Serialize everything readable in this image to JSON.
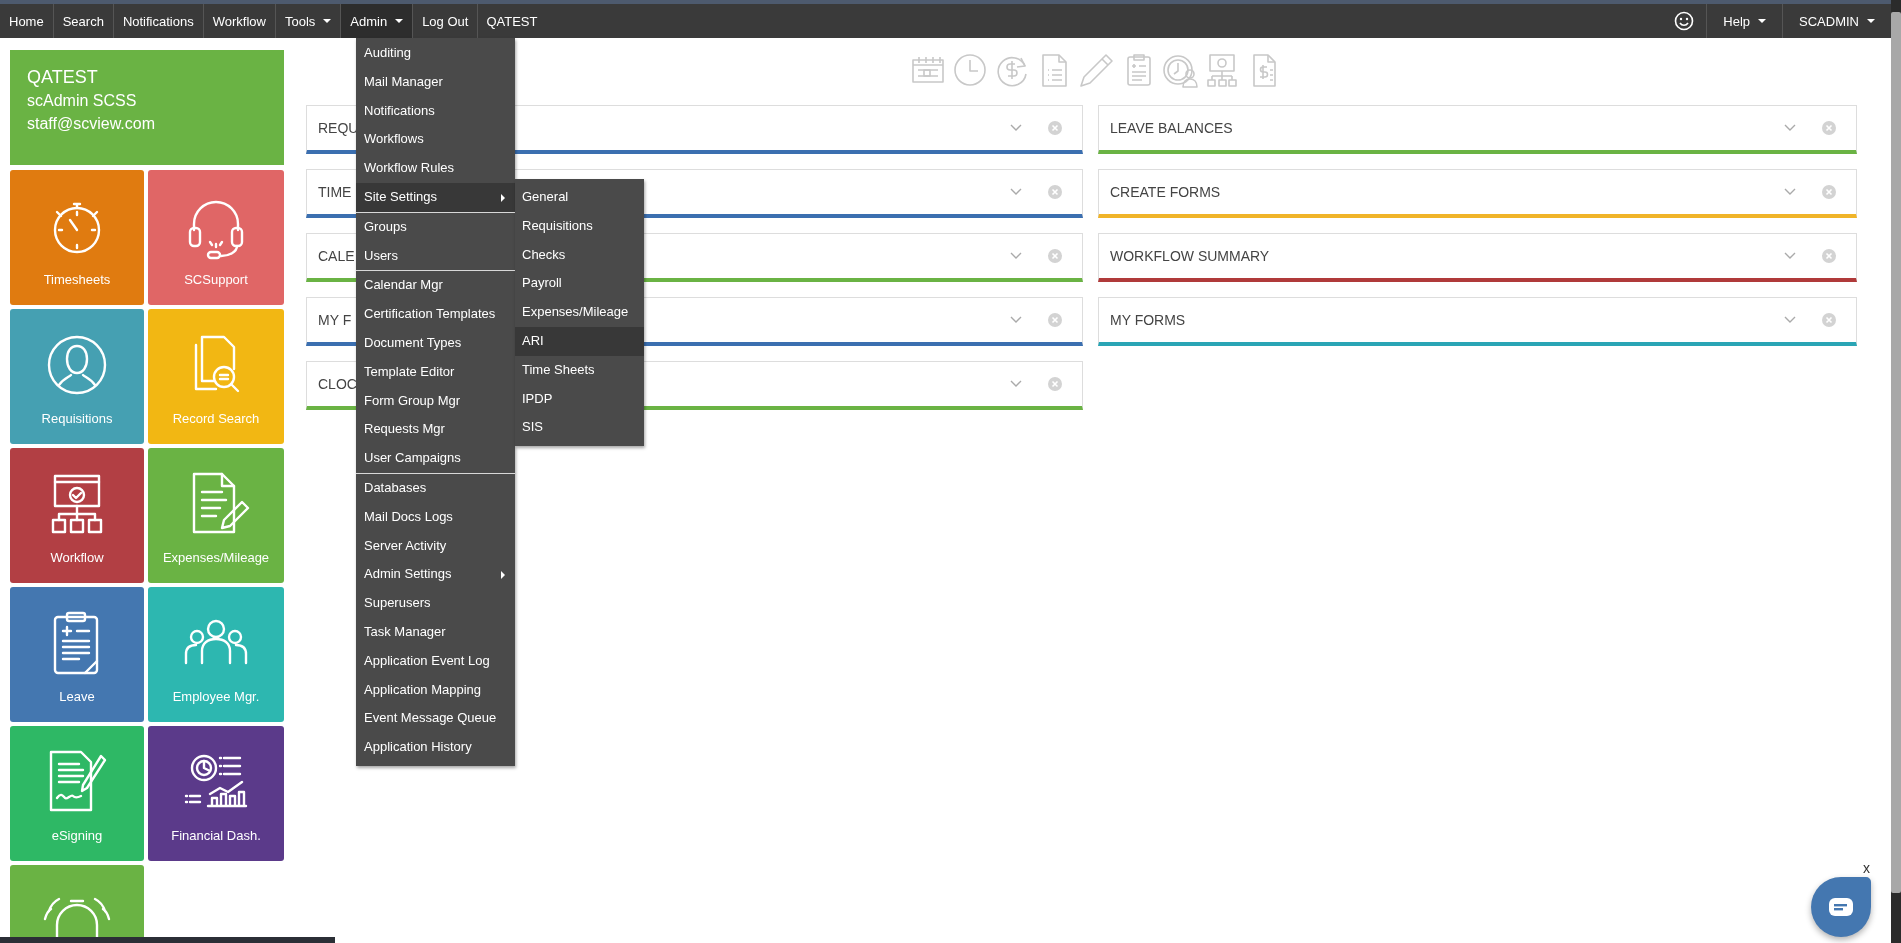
{
  "nav": {
    "items": [
      {
        "label": "Home",
        "selected": false,
        "dropdown": false
      },
      {
        "label": "Search",
        "selected": false,
        "dropdown": false
      },
      {
        "label": "Notifications",
        "selected": false,
        "dropdown": false
      },
      {
        "label": "Workflow",
        "selected": false,
        "dropdown": false
      },
      {
        "label": "Tools",
        "selected": false,
        "dropdown": true
      },
      {
        "label": "Admin",
        "selected": true,
        "dropdown": true
      },
      {
        "label": "Log Out",
        "selected": false,
        "dropdown": false
      }
    ],
    "org": "QATEST",
    "right_items": [
      {
        "label": "Help",
        "dropdown": true
      },
      {
        "label": "SCADMIN",
        "dropdown": true
      }
    ]
  },
  "profile": {
    "lines": [
      "QATEST",
      "scAdmin SCSS",
      "staff@scview.com"
    ]
  },
  "tiles": [
    {
      "label": "Timesheets",
      "kind": "stopwatch",
      "color": "#e07b10"
    },
    {
      "label": "SCSupport",
      "kind": "headset",
      "color": "#e06666"
    },
    {
      "label": "Requisitions",
      "kind": "person",
      "color": "#45a0b2"
    },
    {
      "label": "Record Search",
      "kind": "docsearch",
      "color": "#f2b713"
    },
    {
      "label": "Workflow",
      "kind": "workflow",
      "color": "#b23f44"
    },
    {
      "label": "Expenses/Mileage",
      "kind": "docpen",
      "color": "#6ab344"
    },
    {
      "label": "Leave",
      "kind": "clipboard",
      "color": "#4477b0"
    },
    {
      "label": "Employee Mgr.",
      "kind": "people",
      "color": "#2db7b0"
    },
    {
      "label": "eSigning",
      "kind": "signature",
      "color": "#2eb865"
    },
    {
      "label": "Financial Dash.",
      "kind": "chart",
      "color": "#5b3a8a"
    },
    {
      "kind": "alarm",
      "color": "#6ab344"
    }
  ],
  "widgets": {
    "left": [
      {
        "title": "REQU",
        "color": "#3b6fb0"
      },
      {
        "title": "TIME",
        "color": "#3b6fb0"
      },
      {
        "title": "CALE",
        "color": "#6ab344"
      },
      {
        "title": "MY F",
        "color": "#3b6fb0"
      },
      {
        "title": "CLOC",
        "color": "#6ab344"
      }
    ],
    "right": [
      {
        "title": "LEAVE BALANCES",
        "color": "#6ab344"
      },
      {
        "title": "CREATE FORMS",
        "color": "#f0b429"
      },
      {
        "title": "WORKFLOW SUMMARY",
        "color": "#b03a3a"
      },
      {
        "title": "MY FORMS",
        "color": "#2aa5b5"
      }
    ]
  },
  "admin_menu": {
    "groups": [
      [
        {
          "label": "Auditing",
          "selected": false,
          "submenu": false
        },
        {
          "label": "Mail Manager",
          "selected": false,
          "submenu": false
        },
        {
          "label": "Notifications",
          "selected": false,
          "submenu": false
        },
        {
          "label": "Workflows",
          "selected": false,
          "submenu": false
        },
        {
          "label": "Workflow Rules",
          "selected": false,
          "submenu": false
        },
        {
          "label": "Site Settings",
          "selected": true,
          "submenu": true
        }
      ],
      [
        {
          "label": "Groups",
          "selected": false,
          "submenu": false
        },
        {
          "label": "Users",
          "selected": false,
          "submenu": false
        }
      ],
      [
        {
          "label": "Calendar Mgr",
          "selected": false,
          "submenu": false
        },
        {
          "label": "Certification Templates",
          "selected": false,
          "submenu": false
        },
        {
          "label": "Document Types",
          "selected": false,
          "submenu": false
        },
        {
          "label": "Template Editor",
          "selected": false,
          "submenu": false
        },
        {
          "label": "Form Group Mgr",
          "selected": false,
          "submenu": false
        },
        {
          "label": "Requests Mgr",
          "selected": false,
          "submenu": false
        },
        {
          "label": "User Campaigns",
          "selected": false,
          "submenu": false
        }
      ],
      [
        {
          "label": "Databases",
          "selected": false,
          "submenu": false
        },
        {
          "label": "Mail Docs Logs",
          "selected": false,
          "submenu": false
        },
        {
          "label": "Server Activity",
          "selected": false,
          "submenu": false
        },
        {
          "label": "Admin Settings",
          "selected": false,
          "submenu": true
        },
        {
          "label": "Superusers",
          "selected": false,
          "submenu": false
        },
        {
          "label": "Task Manager",
          "selected": false,
          "submenu": false
        },
        {
          "label": "Application Event Log",
          "selected": false,
          "submenu": false
        },
        {
          "label": "Application Mapping",
          "selected": false,
          "submenu": false
        },
        {
          "label": "Event Message Queue",
          "selected": false,
          "submenu": false
        },
        {
          "label": "Application History",
          "selected": false,
          "submenu": false
        }
      ]
    ],
    "submenu": {
      "items": [
        {
          "label": "General",
          "selected": false
        },
        {
          "label": "Requisitions",
          "selected": false
        },
        {
          "label": "Checks",
          "selected": false
        },
        {
          "label": "Payroll",
          "selected": false
        },
        {
          "label": "Expenses/Mileage",
          "selected": false
        },
        {
          "label": "ARI",
          "selected": true
        },
        {
          "label": "Time Sheets",
          "selected": false
        },
        {
          "label": "IPDP",
          "selected": false
        },
        {
          "label": "SIS",
          "selected": false
        }
      ]
    }
  },
  "chat": {
    "close_label": "x"
  }
}
